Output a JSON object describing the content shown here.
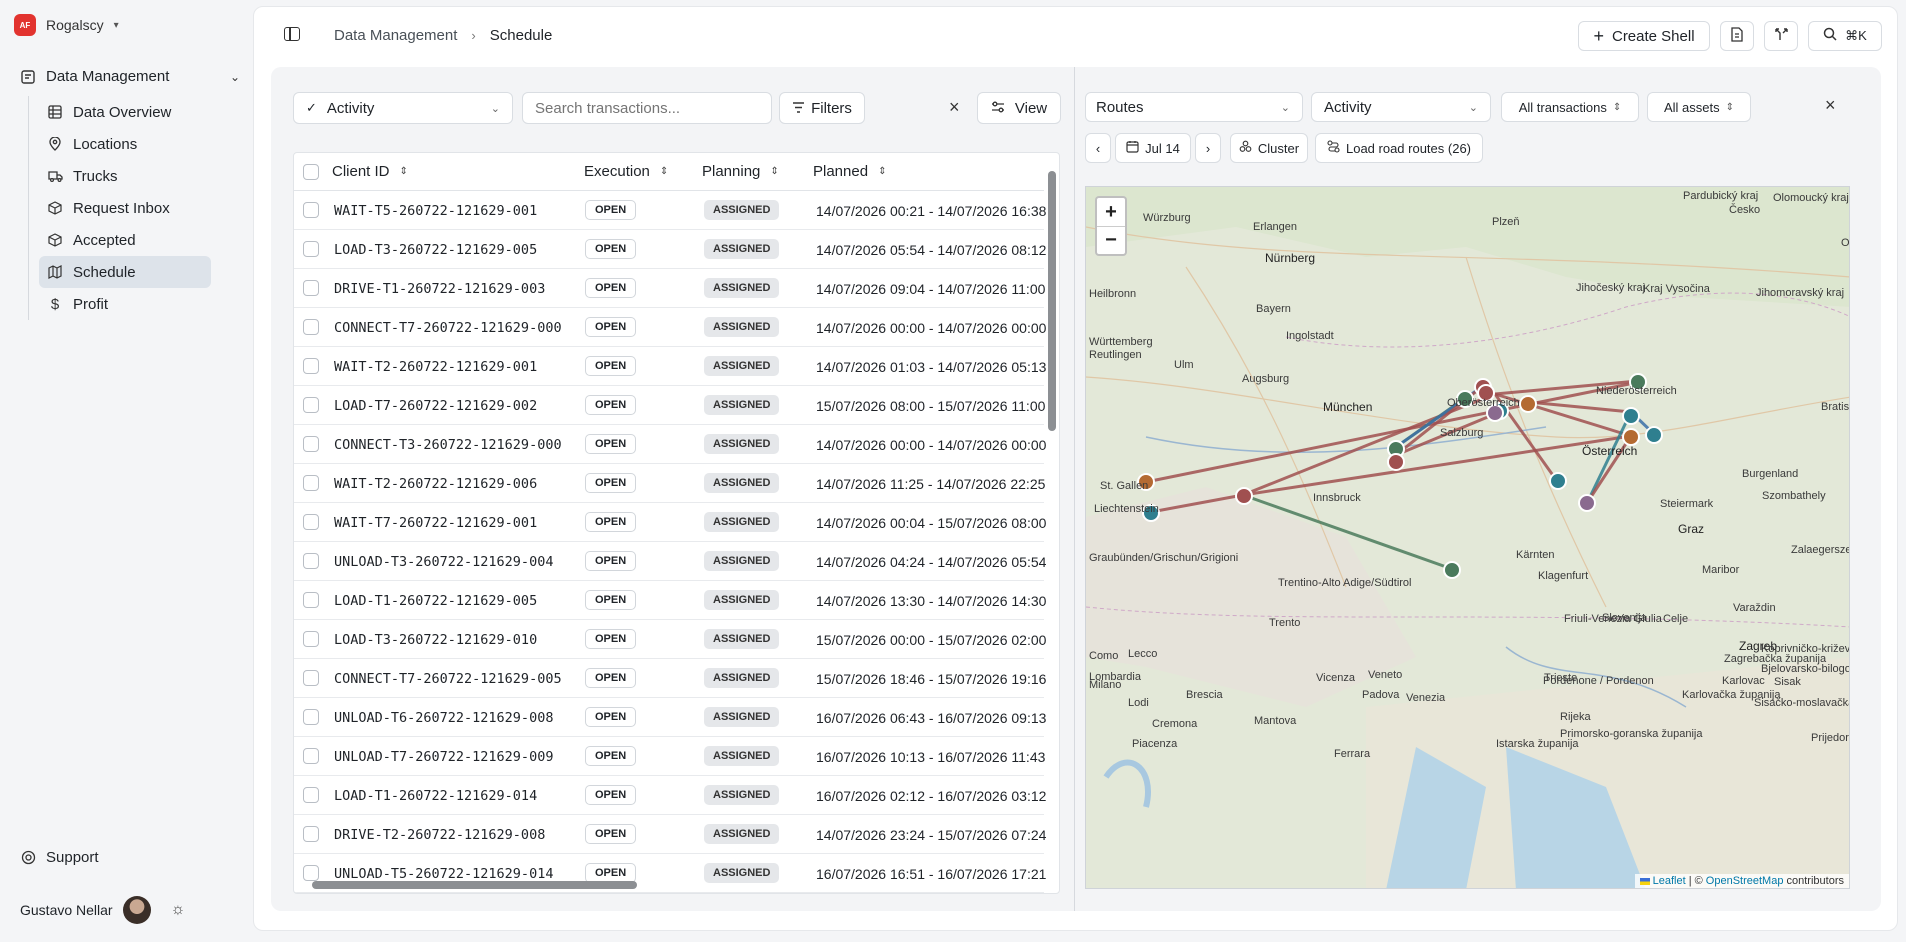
{
  "org": {
    "logo": "AF",
    "name": "Rogalscy"
  },
  "nav": {
    "group_label": "Data Management",
    "items": [
      {
        "label": "Data Overview",
        "icon": "table-icon",
        "active": false
      },
      {
        "label": "Locations",
        "icon": "map-pin-icon",
        "active": false
      },
      {
        "label": "Trucks",
        "icon": "truck-icon",
        "active": false
      },
      {
        "label": "Request Inbox",
        "icon": "package-icon",
        "active": false
      },
      {
        "label": "Accepted",
        "icon": "package-check-icon",
        "active": false
      },
      {
        "label": "Schedule",
        "icon": "map-icon",
        "active": true
      },
      {
        "label": "Profit",
        "icon": "dollar-icon",
        "active": false
      }
    ],
    "support_label": "Support",
    "user_name": "Gustavo Nellar"
  },
  "header": {
    "crumb_parent": "Data Management",
    "crumb_current": "Schedule",
    "create_shell": "Create Shell",
    "shortcut": "⌘K"
  },
  "toolbar": {
    "activity_label": "Activity",
    "search_placeholder": "Search transactions...",
    "filters_label": "Filters",
    "view_label": "View"
  },
  "table": {
    "columns": [
      "Client ID",
      "Execution",
      "Planning",
      "Planned"
    ],
    "rows": [
      {
        "id": "WAIT-T5-260722-121629-001",
        "execution": "OPEN",
        "planning": "ASSIGNED",
        "planned": "14/07/2026 00:21 - 14/07/2026 16:38"
      },
      {
        "id": "LOAD-T3-260722-121629-005",
        "execution": "OPEN",
        "planning": "ASSIGNED",
        "planned": "14/07/2026 05:54 - 14/07/2026 08:12"
      },
      {
        "id": "DRIVE-T1-260722-121629-003",
        "execution": "OPEN",
        "planning": "ASSIGNED",
        "planned": "14/07/2026 09:04 - 14/07/2026 11:00"
      },
      {
        "id": "CONNECT-T7-260722-121629-000",
        "execution": "OPEN",
        "planning": "ASSIGNED",
        "planned": "14/07/2026 00:00 - 14/07/2026 00:00"
      },
      {
        "id": "WAIT-T2-260722-121629-001",
        "execution": "OPEN",
        "planning": "ASSIGNED",
        "planned": "14/07/2026 01:03 - 14/07/2026 05:13"
      },
      {
        "id": "LOAD-T7-260722-121629-002",
        "execution": "OPEN",
        "planning": "ASSIGNED",
        "planned": "15/07/2026 08:00 - 15/07/2026 11:00"
      },
      {
        "id": "CONNECT-T3-260722-121629-000",
        "execution": "OPEN",
        "planning": "ASSIGNED",
        "planned": "14/07/2026 00:00 - 14/07/2026 00:00"
      },
      {
        "id": "WAIT-T2-260722-121629-006",
        "execution": "OPEN",
        "planning": "ASSIGNED",
        "planned": "14/07/2026 11:25 - 14/07/2026 22:25"
      },
      {
        "id": "WAIT-T7-260722-121629-001",
        "execution": "OPEN",
        "planning": "ASSIGNED",
        "planned": "14/07/2026 00:04 - 15/07/2026 08:00"
      },
      {
        "id": "UNLOAD-T3-260722-121629-004",
        "execution": "OPEN",
        "planning": "ASSIGNED",
        "planned": "14/07/2026 04:24 - 14/07/2026 05:54"
      },
      {
        "id": "LOAD-T1-260722-121629-005",
        "execution": "OPEN",
        "planning": "ASSIGNED",
        "planned": "14/07/2026 13:30 - 14/07/2026 14:30"
      },
      {
        "id": "LOAD-T3-260722-121629-010",
        "execution": "OPEN",
        "planning": "ASSIGNED",
        "planned": "15/07/2026 00:00 - 15/07/2026 02:00"
      },
      {
        "id": "CONNECT-T7-260722-121629-005",
        "execution": "OPEN",
        "planning": "ASSIGNED",
        "planned": "15/07/2026 18:46 - 15/07/2026 19:16"
      },
      {
        "id": "UNLOAD-T6-260722-121629-008",
        "execution": "OPEN",
        "planning": "ASSIGNED",
        "planned": "16/07/2026 06:43 - 16/07/2026 09:13"
      },
      {
        "id": "UNLOAD-T7-260722-121629-009",
        "execution": "OPEN",
        "planning": "ASSIGNED",
        "planned": "16/07/2026 10:13 - 16/07/2026 11:43"
      },
      {
        "id": "LOAD-T1-260722-121629-014",
        "execution": "OPEN",
        "planning": "ASSIGNED",
        "planned": "16/07/2026 02:12 - 16/07/2026 03:12"
      },
      {
        "id": "DRIVE-T2-260722-121629-008",
        "execution": "OPEN",
        "planning": "ASSIGNED",
        "planned": "14/07/2026 23:24 - 15/07/2026 07:24"
      },
      {
        "id": "UNLOAD-T5-260722-121629-014",
        "execution": "OPEN",
        "planning": "ASSIGNED",
        "planned": "16/07/2026 16:51 - 16/07/2026 17:21"
      }
    ]
  },
  "map_controls": {
    "routes_label": "Routes",
    "activity_label": "Activity",
    "transactions_label": "All transactions",
    "assets_label": "All assets",
    "date_label": "Jul 14",
    "cluster_label": "Cluster",
    "load_routes_label": "Load road routes (26)"
  },
  "map": {
    "places": [
      "Würzburg",
      "Erlangen",
      "Plzeň",
      "Nürnberg",
      "Heilbronn",
      "Česko",
      "Pardubický kraj",
      "Olomoucký kraj",
      "Ingolstadt",
      "Bayern",
      "Jihočeský kraj",
      "Kraj Vysočina",
      "Jihomoravský kraj",
      "Olom",
      "Ulm",
      "Augsburg",
      "Württemberg",
      "Reutlingen",
      "München",
      "Oberösterreich",
      "Niederösterreich",
      "Bratislava",
      "Salzburg",
      "Österreich",
      "St. Gallen",
      "Liechtenstein",
      "Innsbruck",
      "Burgenland",
      "Steiermark",
      "Szombathely",
      "Graz",
      "Zalaegerszeg",
      "Graubünden/Grischun/Grigioni",
      "Kärnten",
      "Klagenfurt",
      "Maribor",
      "Trentino-Alto Adige/Südtirol",
      "Slovenija",
      "Celje",
      "Varaždin",
      "Zagreb",
      "Lombardia",
      "Friuli-Venezia Giulia",
      "Pordenone / Pordenon",
      "Trento",
      "Como",
      "Lecco",
      "Bjelovarsko-bilogorska županija",
      "Milano",
      "Brescia",
      "Vicenza",
      "Padova",
      "Veneto",
      "Venezia",
      "Trieste",
      "Karlovac",
      "Sisak",
      "Lodi",
      "Cremona",
      "Mantova",
      "Rijeka",
      "Ferrara",
      "Piacenza",
      "Primorsko-goranska županija",
      "Istarska županija",
      "Koprivničko-križevačka županija",
      "Sisačko-moslavačka županija",
      "Karlovačka županija",
      "Prijedor",
      "Zagrebačka županija"
    ],
    "attribution_leaflet": "Leaflet",
    "attribution_osm": "OpenStreetMap",
    "attribution_suffix": "contributors",
    "attribution_sep": "|",
    "attribution_copy": "©",
    "colors": {
      "red": "#a05050",
      "green": "#4a7a5c",
      "teal": "#2f7f8f",
      "brown": "#b46a32",
      "purple": "#8a6a8f",
      "blue": "#3b6fa8"
    }
  }
}
